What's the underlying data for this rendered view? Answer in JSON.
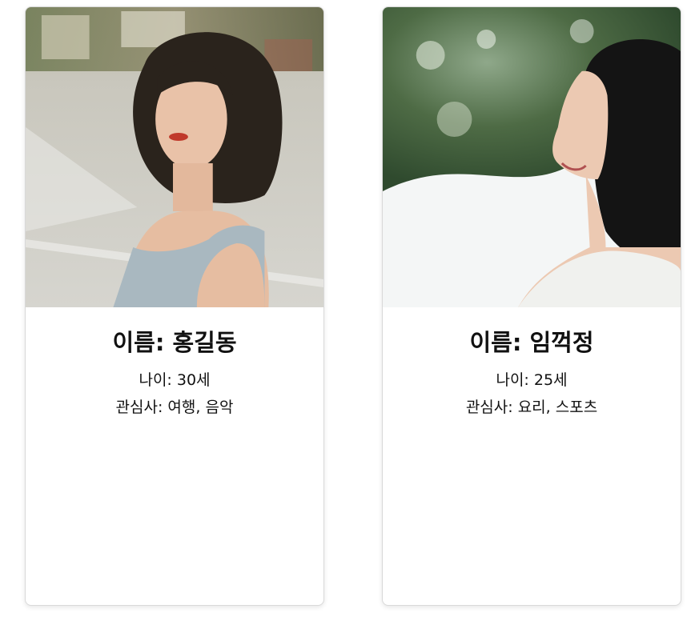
{
  "cards": [
    {
      "name_label": "이름: 홍길동",
      "age_label": "나이: 30세",
      "interests_label": "관심사: 여행, 음악",
      "photo_icon": "profile-photo-woman-street"
    },
    {
      "name_label": "이름: 임꺽정",
      "age_label": "나이: 25세",
      "interests_label": "관심사: 요리, 스포츠",
      "photo_icon": "profile-photo-woman-smiling-profile"
    }
  ],
  "colors": {
    "card_border": "#d9d9d9",
    "text": "#111111",
    "background": "#ffffff"
  }
}
